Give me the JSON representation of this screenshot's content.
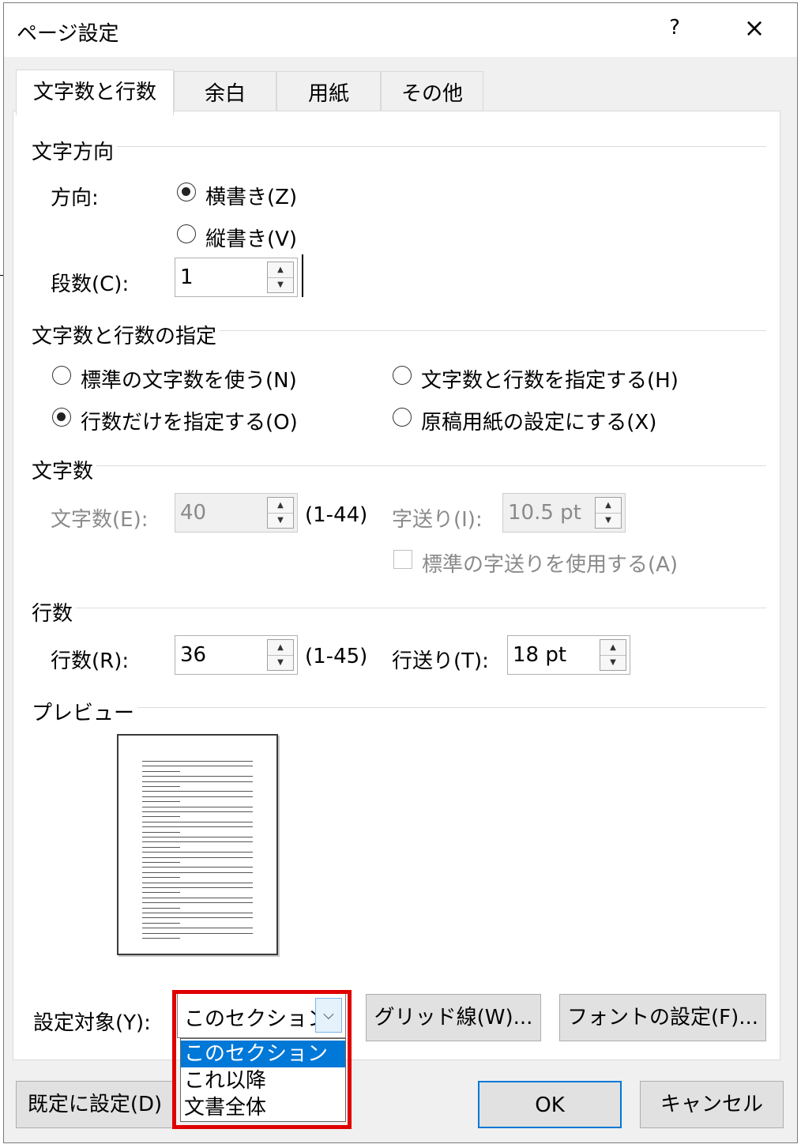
{
  "window": {
    "title": "ページ設定",
    "help": "?",
    "close": "×"
  },
  "tabs": [
    "文字数と行数",
    "余白",
    "用紙",
    "その他"
  ],
  "direction": {
    "group": "文字方向",
    "label": "方向:",
    "options": [
      "横書き(Z)",
      "縦書き(V)"
    ],
    "selected": 0,
    "columns_label": "段数(C):",
    "columns_value": "1"
  },
  "spec": {
    "group": "文字数と行数の指定",
    "options": [
      "標準の文字数を使う(N)",
      "文字数と行数を指定する(H)",
      "行数だけを指定する(O)",
      "原稿用紙の設定にする(X)"
    ],
    "selected": 2
  },
  "chars": {
    "group": "文字数",
    "count_label": "文字数(E):",
    "count_value": "40",
    "count_range": "(1-44)",
    "pitch_label": "字送り(I):",
    "pitch_value": "10.5 pt",
    "default_pitch_label": "標準の字送りを使用する(A)"
  },
  "lines": {
    "group": "行数",
    "count_label": "行数(R):",
    "count_value": "36",
    "count_range": "(1-45)",
    "pitch_label": "行送り(T):",
    "pitch_value": "18 pt"
  },
  "preview": {
    "group": "プレビュー"
  },
  "apply": {
    "label": "設定対象(Y):",
    "value": "このセクション",
    "options": [
      "このセクション",
      "これ以降",
      "文書全体"
    ],
    "selected": 0
  },
  "buttons": {
    "grid": "グリッド線(W)...",
    "font": "フォントの設定(F)...",
    "default": "既定に設定(D)",
    "ok": "OK",
    "cancel": "キャンセル"
  },
  "colors": {
    "accent": "#0078d7",
    "highlight": "#e00000"
  }
}
